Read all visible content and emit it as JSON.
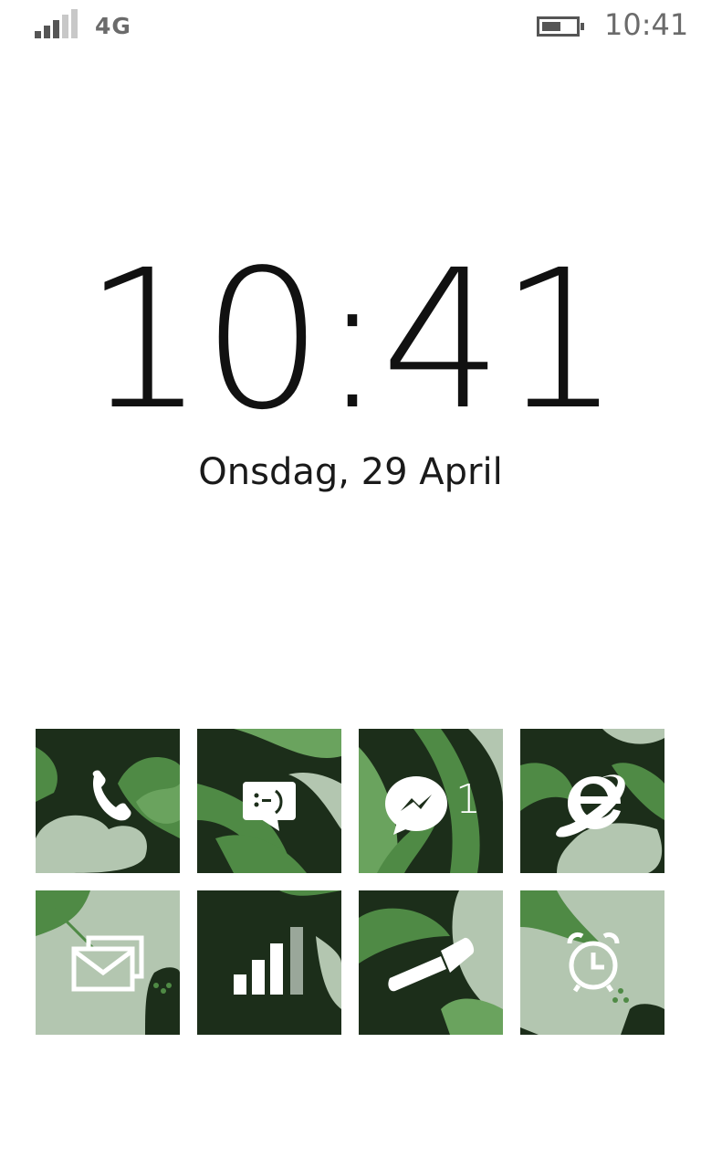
{
  "status_bar": {
    "network": "4G",
    "time": "10:41",
    "signal_icon": "signal-strength-icon",
    "battery_icon": "battery-icon"
  },
  "lock_screen": {
    "time": "10:41",
    "date": "Onsdag, 29 April"
  },
  "tiles": [
    {
      "icon": "phone-icon",
      "badge": ""
    },
    {
      "icon": "messaging-icon",
      "badge": ""
    },
    {
      "icon": "messenger-icon",
      "badge": "1"
    },
    {
      "icon": "internet-explorer-icon",
      "badge": ""
    },
    {
      "icon": "mail-icon",
      "badge": ""
    },
    {
      "icon": "signal-bars-icon",
      "badge": ""
    },
    {
      "icon": "flashlight-icon",
      "badge": ""
    },
    {
      "icon": "alarm-clock-icon",
      "badge": ""
    }
  ],
  "colors": {
    "tile_dark": "#1c2e1a",
    "leaf_green": "#4f8a45",
    "flower_pale": "#b3c6b0",
    "status_gray": "#6b6b6b"
  }
}
